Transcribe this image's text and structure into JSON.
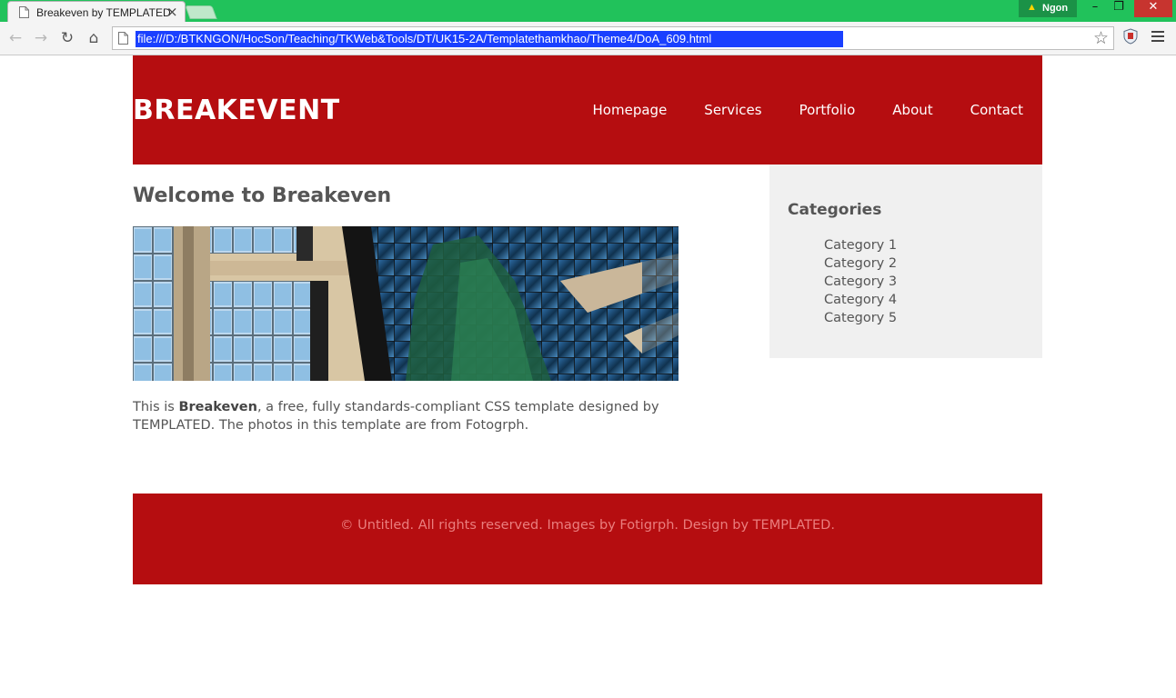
{
  "browser": {
    "tab_title": "Breakeven by TEMPLATED",
    "tab_close": "×",
    "profile_name": "Ngon",
    "url": "file:///D:/BTKNGON/HocSon/Teaching/TKWeb&Tools/DT/UK15-2A/Templatethamkhao/Theme4/DoA_609.html",
    "window_controls": {
      "minimize": "–",
      "maximize": "❐",
      "close": "✕"
    },
    "nav": {
      "back": "←",
      "forward": "→",
      "reload": "↻",
      "home": "⌂",
      "star": "☆"
    }
  },
  "site": {
    "logo": "BREAKEVENT",
    "nav": [
      "Homepage",
      "Services",
      "Portfolio",
      "About",
      "Contact"
    ],
    "main": {
      "title": "Welcome to Breakeven",
      "intro_pre": "This is ",
      "intro_bold": "Breakeven",
      "intro_post": ", a free, fully standards-compliant CSS template designed by TEMPLATED. The photos in this template are from Fotogrph."
    },
    "sidebar": {
      "title": "Categories",
      "items": [
        "Category 1",
        "Category 2",
        "Category 3",
        "Category 4",
        "Category 5"
      ]
    },
    "footer": "© Untitled. All rights reserved. Images by Fotigrph. Design by TEMPLATED."
  },
  "colors": {
    "titlebar": "#21c25b",
    "brand_red": "#b50d10",
    "sidebar_bg": "#f0f0f0",
    "footer_text": "#ea7e7e"
  }
}
